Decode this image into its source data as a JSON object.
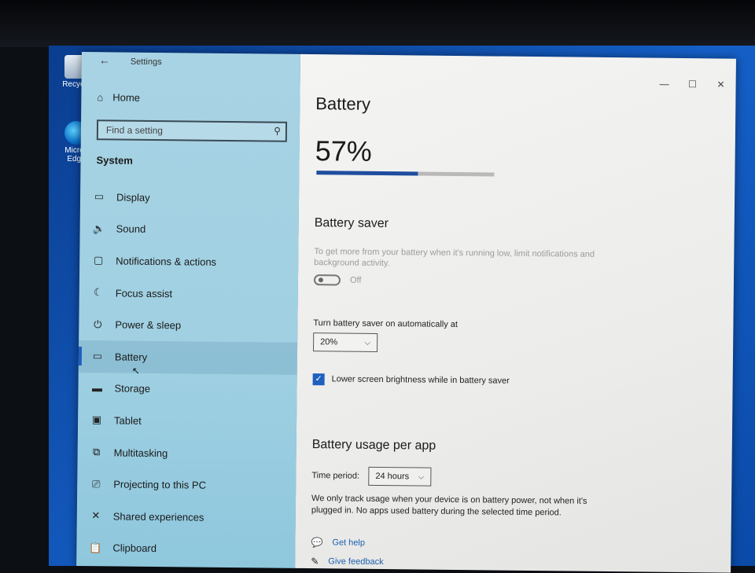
{
  "desktop": {
    "icons": [
      {
        "label": "Recycle"
      },
      {
        "label": "Micros\nEdge"
      }
    ]
  },
  "window": {
    "app_title": "Settings",
    "controls": {
      "minimize": "—",
      "maximize": "☐",
      "close": "✕"
    }
  },
  "sidebar": {
    "home_label": "Home",
    "search": {
      "placeholder": "Find a setting"
    },
    "section_label": "System",
    "items": [
      {
        "label": "Display",
        "icon": "display-icon"
      },
      {
        "label": "Sound",
        "icon": "sound-icon"
      },
      {
        "label": "Notifications & actions",
        "icon": "notifications-icon"
      },
      {
        "label": "Focus assist",
        "icon": "moon-icon"
      },
      {
        "label": "Power & sleep",
        "icon": "power-icon"
      },
      {
        "label": "Battery",
        "icon": "battery-icon",
        "active": true
      },
      {
        "label": "Storage",
        "icon": "storage-icon"
      },
      {
        "label": "Tablet",
        "icon": "tablet-icon"
      },
      {
        "label": "Multitasking",
        "icon": "multitasking-icon"
      },
      {
        "label": "Projecting to this PC",
        "icon": "projecting-icon"
      },
      {
        "label": "Shared experiences",
        "icon": "shared-icon"
      },
      {
        "label": "Clipboard",
        "icon": "clipboard-icon"
      }
    ]
  },
  "main": {
    "title": "Battery",
    "battery_percent": "57%",
    "battery_level": 0.57,
    "saver": {
      "title": "Battery saver",
      "description": "To get more from your battery when it's running low, limit notifications and background activity.",
      "toggle_state": "Off",
      "auto_label": "Turn battery saver on automatically at",
      "threshold": "20%",
      "brightness_label": "Lower screen brightness while in battery saver",
      "brightness_checked": true
    },
    "usage": {
      "title": "Battery usage per app",
      "period_label": "Time period:",
      "period_value": "24 hours",
      "description": "We only track usage when your device is on battery power, not when it's plugged in. No apps used battery during the selected time period."
    },
    "links": {
      "help": "Get help",
      "feedback": "Give feedback"
    }
  },
  "colors": {
    "accent": "#1f5fbf",
    "sidebar_bg": "#a8d3e4",
    "main_bg": "#f0f0ee"
  }
}
